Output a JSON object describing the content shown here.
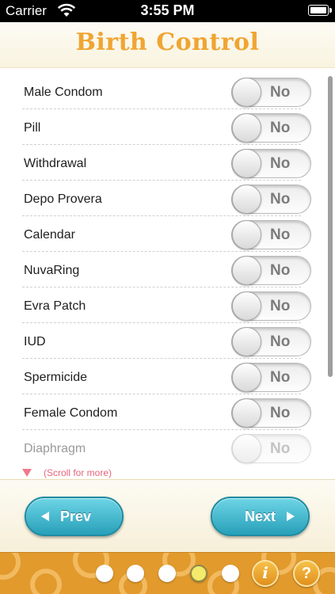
{
  "status_bar": {
    "carrier": "Carrier",
    "time": "3:55 PM",
    "icons": [
      "wifi-icon",
      "battery-icon"
    ]
  },
  "header": {
    "title": "Birth Control"
  },
  "methods": [
    {
      "label": "Male Condom",
      "state": "No"
    },
    {
      "label": "Pill",
      "state": "No"
    },
    {
      "label": "Withdrawal",
      "state": "No"
    },
    {
      "label": "Depo Provera",
      "state": "No"
    },
    {
      "label": "Calendar",
      "state": "No"
    },
    {
      "label": "NuvaRing",
      "state": "No"
    },
    {
      "label": "Evra Patch",
      "state": "No"
    },
    {
      "label": "IUD",
      "state": "No"
    },
    {
      "label": "Spermicide",
      "state": "No"
    },
    {
      "label": "Female Condom",
      "state": "No"
    },
    {
      "label": "Diaphragm",
      "state": "No"
    }
  ],
  "scroll_hint": "(Scroll for more)",
  "nav": {
    "prev_label": "Prev",
    "next_label": "Next"
  },
  "footer": {
    "page_dots": 5,
    "active_dot": 4,
    "info_label": "i",
    "help_label": "?"
  },
  "colors": {
    "title": "#f0a532",
    "button": "#27a0b9",
    "footer": "#e29a2c",
    "scroll_hint": "#e5657b"
  }
}
